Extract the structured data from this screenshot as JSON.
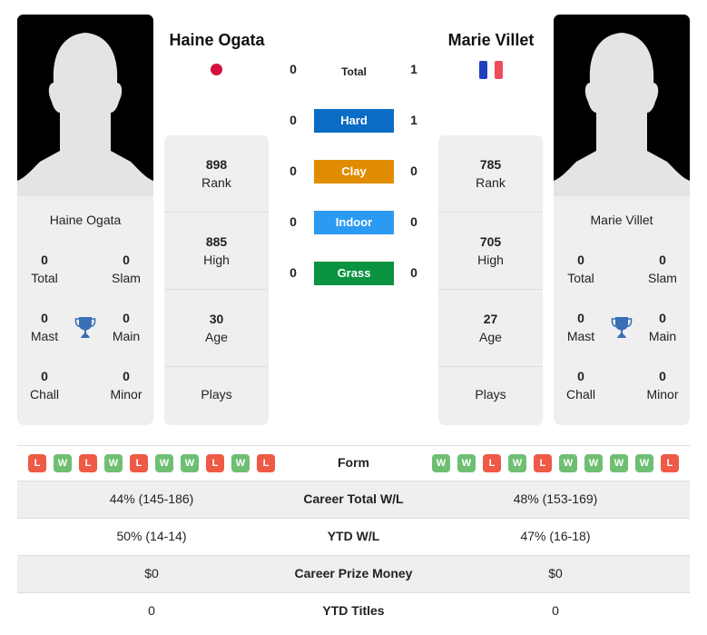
{
  "players": {
    "left": {
      "name": "Haine Ogata",
      "country_flag": "japan-flag",
      "titles": {
        "total": "0",
        "slam": "0",
        "mast": "0",
        "main": "0",
        "chall": "0",
        "minor": "0"
      },
      "rank": "898",
      "high": "885",
      "age": "30",
      "plays": ""
    },
    "right": {
      "name": "Marie Villet",
      "country_flag": "france-flag",
      "titles": {
        "total": "0",
        "slam": "0",
        "mast": "0",
        "main": "0",
        "chall": "0",
        "minor": "0"
      },
      "rank": "785",
      "high": "705",
      "age": "27",
      "plays": ""
    }
  },
  "labels": {
    "total": "Total",
    "slam": "Slam",
    "mast": "Mast",
    "main": "Main",
    "chall": "Chall",
    "minor": "Minor",
    "rank": "Rank",
    "high": "High",
    "age": "Age",
    "plays": "Plays"
  },
  "h2h": {
    "rows": [
      {
        "label": "Total",
        "left": "0",
        "right": "1",
        "color": ""
      },
      {
        "label": "Hard",
        "left": "0",
        "right": "1",
        "color": "#0a6cc4"
      },
      {
        "label": "Clay",
        "left": "0",
        "right": "0",
        "color": "#e08c00"
      },
      {
        "label": "Indoor",
        "left": "0",
        "right": "0",
        "color": "#2b9af3"
      },
      {
        "label": "Grass",
        "left": "0",
        "right": "0",
        "color": "#0a9340"
      }
    ]
  },
  "form": {
    "label": "Form",
    "left": [
      "L",
      "W",
      "L",
      "W",
      "L",
      "W",
      "W",
      "L",
      "W",
      "L"
    ],
    "right": [
      "W",
      "W",
      "L",
      "W",
      "L",
      "W",
      "W",
      "W",
      "W",
      "L"
    ]
  },
  "stats": [
    {
      "label": "Career Total W/L",
      "left": "44% (145-186)",
      "right": "48% (153-169)"
    },
    {
      "label": "YTD W/L",
      "left": "50% (14-14)",
      "right": "47% (16-18)"
    },
    {
      "label": "Career Prize Money",
      "left": "$0",
      "right": "$0"
    },
    {
      "label": "YTD Titles",
      "left": "0",
      "right": "0"
    }
  ],
  "colors": {
    "win": "#6fbf73",
    "loss": "#ee5a45",
    "trophy": "#3a6fb8"
  }
}
